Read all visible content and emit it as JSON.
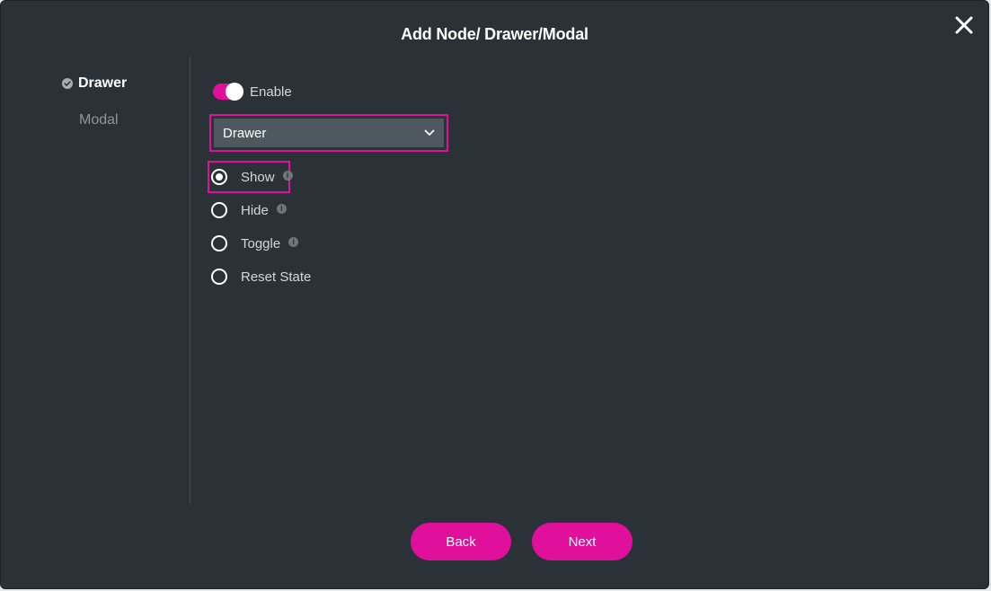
{
  "dialog": {
    "title": "Add Node/ Drawer/Modal",
    "close_icon": "close-icon"
  },
  "steps": [
    {
      "label": "Drawer",
      "state": "active",
      "icon": "check-circle-icon"
    },
    {
      "label": "Modal",
      "state": "inactive"
    }
  ],
  "enable_toggle": {
    "label": "Enable",
    "on": true
  },
  "type_select": {
    "value": "Drawer",
    "icon": "chevron-down-icon"
  },
  "actions": [
    {
      "label": "Show",
      "selected": true,
      "info": true
    },
    {
      "label": "Hide",
      "selected": false,
      "info": true
    },
    {
      "label": "Toggle",
      "selected": false,
      "info": true
    },
    {
      "label": "Reset State",
      "selected": false,
      "info": false
    }
  ],
  "footer": {
    "back_label": "Back",
    "next_label": "Next"
  },
  "colors": {
    "accent": "#e0109c",
    "panel_bg": "#2a3238",
    "select_bg": "#4e585f"
  }
}
